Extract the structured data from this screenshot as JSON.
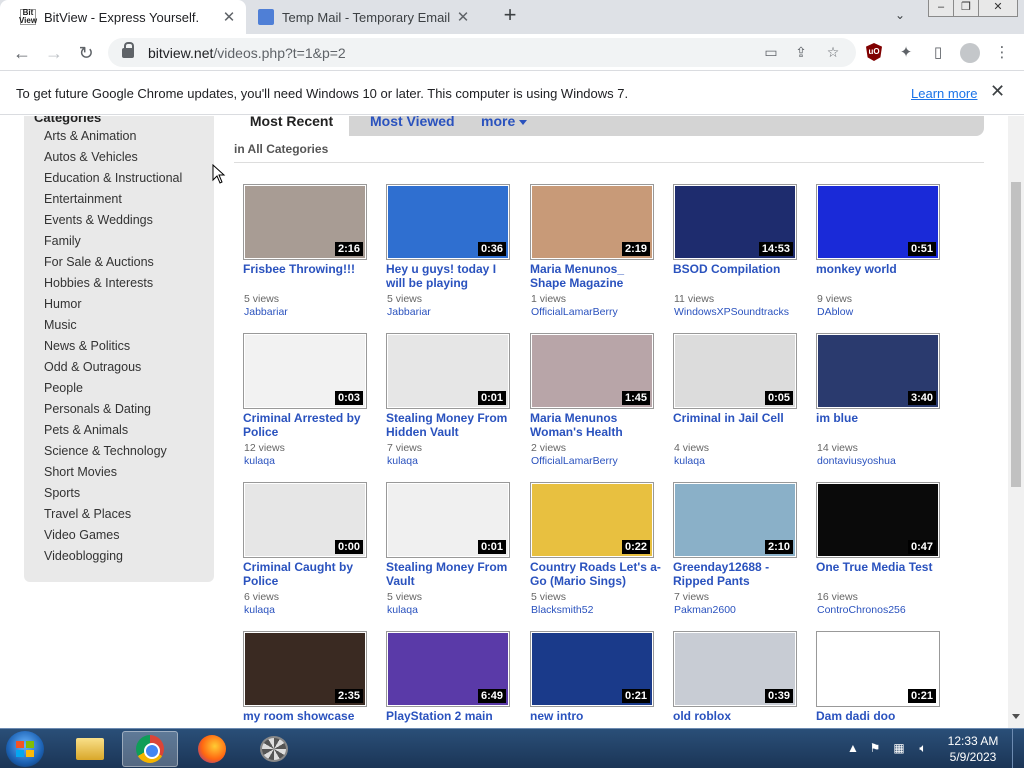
{
  "browser": {
    "tabs": [
      {
        "title": "BitView - Express Yourself.",
        "favicon": "bitview-logo",
        "active": true
      },
      {
        "title": "Temp Mail - Temporary Email",
        "favicon": "mail-icon",
        "active": false
      }
    ],
    "new_tab": "+",
    "url_host": "bitview.net",
    "url_path": "/videos.php?t=1&p=2"
  },
  "infobar": {
    "message": "To get future Google Chrome updates, you'll need Windows 10 or later. This computer is using Windows 7.",
    "learn_more": "Learn more"
  },
  "sidebar": {
    "title": "Categories",
    "items": [
      "Arts & Animation",
      "Autos & Vehicles",
      "Education & Instructional",
      "Entertainment",
      "Events & Weddings",
      "Family",
      "For Sale & Auctions",
      "Hobbies & Interests",
      "Humor",
      "Music",
      "News & Politics",
      "Odd & Outragous",
      "People",
      "Personals & Dating",
      "Pets & Animals",
      "Science & Technology",
      "Short Movies",
      "Sports",
      "Travel & Places",
      "Video Games",
      "Videoblogging"
    ]
  },
  "tabs": {
    "most_recent": "Most Recent",
    "most_viewed": "Most Viewed",
    "more": "more",
    "subtitle": "in All Categories"
  },
  "videos": [
    {
      "title": "Frisbee Throwing!!!",
      "duration": "2:16",
      "views": "5 views",
      "author": "Jabbariar",
      "thumb": "#a89c94"
    },
    {
      "title": "Hey u guys! today I will be playing",
      "duration": "0:36",
      "views": "5 views",
      "author": "Jabbariar",
      "thumb": "#2f6fd0"
    },
    {
      "title": "Maria Menunos_ Shape Magazine",
      "duration": "2:19",
      "views": "1 views",
      "author": "OfficialLamarBerry",
      "thumb": "#c89a78"
    },
    {
      "title": "BSOD Compilation",
      "duration": "14:53",
      "views": "11 views",
      "author": "WindowsXPSoundtracks",
      "thumb": "#1e2c6e"
    },
    {
      "title": "monkey world",
      "duration": "0:51",
      "views": "9 views",
      "author": "DAblow",
      "thumb": "#1a2ad8"
    },
    {
      "title": "Criminal Arrested by Police",
      "duration": "0:03",
      "views": "12 views",
      "author": "kulaqa",
      "thumb": "#f2f2f2"
    },
    {
      "title": "Stealing Money From Hidden Vault",
      "duration": "0:01",
      "views": "7 views",
      "author": "kulaqa",
      "thumb": "#e6e6e6"
    },
    {
      "title": "Maria Menunos Woman's Health",
      "duration": "1:45",
      "views": "2 views",
      "author": "OfficialLamarBerry",
      "thumb": "#b8a5a8"
    },
    {
      "title": "Criminal in Jail Cell",
      "duration": "0:05",
      "views": "4 views",
      "author": "kulaqa",
      "thumb": "#dcdcdc"
    },
    {
      "title": "im blue",
      "duration": "3:40",
      "views": "14 views",
      "author": "dontaviusyoshua",
      "thumb": "#2a3a6e"
    },
    {
      "title": "Criminal Caught by Police",
      "duration": "0:00",
      "views": "6 views",
      "author": "kulaqa",
      "thumb": "#e6e6e6"
    },
    {
      "title": "Stealing Money From Vault",
      "duration": "0:01",
      "views": "5 views",
      "author": "kulaqa",
      "thumb": "#f0f0f0"
    },
    {
      "title": "Country Roads Let's a-Go (Mario Sings)",
      "duration": "0:22",
      "views": "5 views",
      "author": "Blacksmith52",
      "thumb": "#e8c040"
    },
    {
      "title": "Greenday12688 - Ripped Pants",
      "duration": "2:10",
      "views": "7 views",
      "author": "Pakman2600",
      "thumb": "#8ab0c8"
    },
    {
      "title": "One True Media Test",
      "duration": "0:47",
      "views": "16 views",
      "author": "ControChronos256",
      "thumb": "#0a0a0a"
    },
    {
      "title": "my room showcase",
      "duration": "2:35",
      "views": "",
      "author": "",
      "thumb": "#3a2a22"
    },
    {
      "title": "PlayStation 2 main",
      "duration": "6:49",
      "views": "",
      "author": "",
      "thumb": "#5a3aa8"
    },
    {
      "title": "new intro",
      "duration": "0:21",
      "views": "",
      "author": "",
      "thumb": "#1a3a8a"
    },
    {
      "title": "old roblox",
      "duration": "0:39",
      "views": "",
      "author": "",
      "thumb": "#c8ccd4"
    },
    {
      "title": "Dam dadi doo",
      "duration": "0:21",
      "views": "",
      "author": "",
      "thumb": "#ffffff"
    }
  ],
  "taskbar": {
    "time": "12:33 AM",
    "date": "5/9/2023"
  }
}
